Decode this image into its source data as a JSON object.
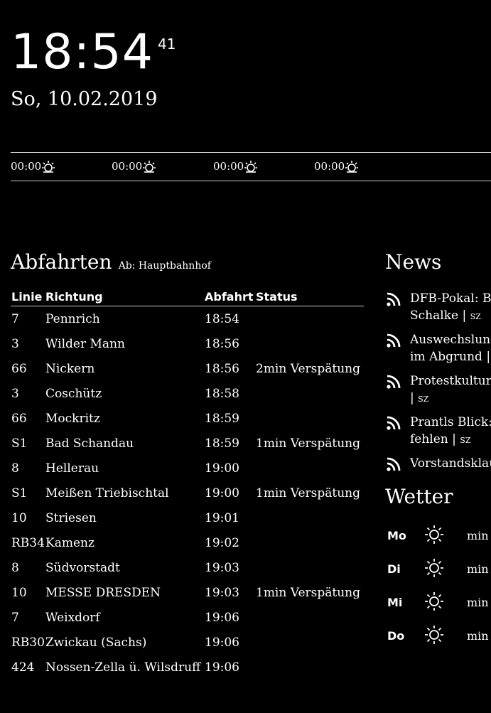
{
  "clock": {
    "time": "18:54",
    "seconds": "41",
    "date": "So, 10.02.2019"
  },
  "sun": [
    {
      "time": "00:00",
      "icon": "sun-rise-icon"
    },
    {
      "time": "00:00",
      "icon": "sun-rise-icon"
    },
    {
      "time": "00:00",
      "icon": "sun-rise-icon"
    },
    {
      "time": "00:00",
      "icon": "sun-rise-icon"
    }
  ],
  "departures": {
    "title": "Abfahrten",
    "subtitle": "Ab: Hauptbahnhof",
    "columns": [
      "Linie",
      "Richtung",
      "Abfahrt",
      "Status"
    ],
    "rows": [
      {
        "line": "7",
        "direction": "Pennrich",
        "time": "18:54",
        "status": ""
      },
      {
        "line": "3",
        "direction": "Wilder Mann",
        "time": "18:56",
        "status": ""
      },
      {
        "line": "66",
        "direction": "Nickern",
        "time": "18:56",
        "status": "2min Verspätung"
      },
      {
        "line": "3",
        "direction": "Coschütz",
        "time": "18:58",
        "status": ""
      },
      {
        "line": "66",
        "direction": "Mockritz",
        "time": "18:59",
        "status": ""
      },
      {
        "line": "S1",
        "direction": "Bad Schandau",
        "time": "18:59",
        "status": "1min Verspätung"
      },
      {
        "line": "8",
        "direction": "Hellerau",
        "time": "19:00",
        "status": ""
      },
      {
        "line": "S1",
        "direction": "Meißen Triebischtal",
        "time": "19:00",
        "status": "1min Verspätung"
      },
      {
        "line": "10",
        "direction": "Striesen",
        "time": "19:01",
        "status": ""
      },
      {
        "line": "RB34",
        "direction": "Kamenz",
        "time": "19:02",
        "status": ""
      },
      {
        "line": "8",
        "direction": "Südvorstadt",
        "time": "19:03",
        "status": ""
      },
      {
        "line": "10",
        "direction": "MESSE DRESDEN",
        "time": "19:03",
        "status": "1min Verspätung"
      },
      {
        "line": "7",
        "direction": "Weixdorf",
        "time": "19:06",
        "status": ""
      },
      {
        "line": "RB30",
        "direction": "Zwickau (Sachs)",
        "time": "19:06",
        "status": ""
      },
      {
        "line": "424",
        "direction": "Nossen-Zella ü. Wilsdruff",
        "time": "19:06",
        "status": ""
      }
    ]
  },
  "news": {
    "title": "News",
    "items": [
      {
        "lines": [
          "DFB-Pokal: Bay",
          "Schalke | "
        ],
        "source": "SZ",
        "icon": "rss-icon"
      },
      {
        "lines": [
          "Auswechslung",
          "im Abgrund | "
        ],
        "source": "SZ",
        "icon": "rss-icon"
      },
      {
        "lines": [
          "Protestkultur: E",
          "| "
        ],
        "source": "SZ",
        "icon": "rss-icon"
      },
      {
        "lines": [
          "Prantls Blick: W",
          "fehlen | "
        ],
        "source": "SZ",
        "icon": "rss-icon"
      },
      {
        "lines": [
          "Vorstandsklaus"
        ],
        "source": "",
        "icon": "rss-icon"
      }
    ]
  },
  "weather": {
    "title": "Wetter",
    "days": [
      {
        "day": "Mo",
        "icon": "sun-icon",
        "min": "min"
      },
      {
        "day": "Di",
        "icon": "sun-icon",
        "min": "min"
      },
      {
        "day": "Mi",
        "icon": "sun-icon",
        "min": "min"
      },
      {
        "day": "Do",
        "icon": "sun-icon",
        "min": "min"
      }
    ]
  }
}
